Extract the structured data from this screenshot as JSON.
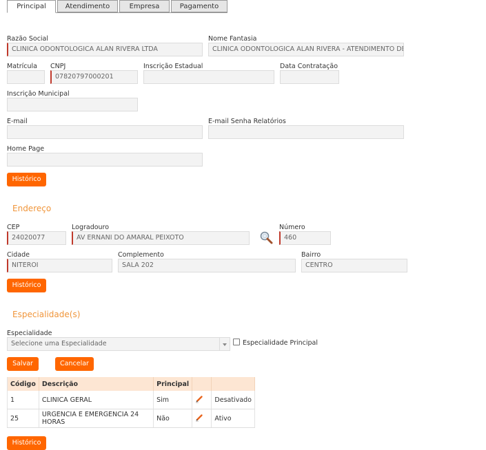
{
  "tabs": [
    {
      "label": "Principal"
    },
    {
      "label": "Atendimento"
    },
    {
      "label": "Empresa"
    },
    {
      "label": "Pagamento"
    }
  ],
  "principal": {
    "razao_social_label": "Razão Social",
    "razao_social_value": "CLINICA ODONTOLOGICA ALAN RIVERA LTDA",
    "nome_fantasia_label": "Nome Fantasia",
    "nome_fantasia_value": "CLINICA ODONTOLOGICA ALAN RIVERA - ATENDIMENTO DE U",
    "matricula_label": "Matrícula",
    "matricula_value": "",
    "cnpj_label": "CNPJ",
    "cnpj_value": "07820797000201",
    "inscricao_estadual_label": "Inscrição Estadual",
    "inscricao_estadual_value": "",
    "data_contratacao_label": "Data Contratação",
    "data_contratacao_value": "",
    "inscricao_municipal_label": "Inscrição Municipal",
    "inscricao_municipal_value": "",
    "email_label": "E-mail",
    "email_value": "",
    "email_senha_label": "E-mail Senha Relatórios",
    "email_senha_value": "",
    "home_page_label": "Home Page",
    "home_page_value": "",
    "historico_label": "Histórico"
  },
  "endereco": {
    "title": "Endereço",
    "cep_label": "CEP",
    "cep_value": "24020077",
    "logradouro_label": "Logradouro",
    "logradouro_value": "AV ERNANI DO AMARAL PEIXOTO",
    "numero_label": "Número",
    "numero_value": "460",
    "cidade_label": "Cidade",
    "cidade_value": "NITEROI",
    "complemento_label": "Complemento",
    "complemento_value": "SALA 202",
    "bairro_label": "Bairro",
    "bairro_value": "CENTRO",
    "historico_label": "Histórico"
  },
  "especialidades": {
    "title": "Especialidade(s)",
    "especialidade_label": "Especialidade",
    "select_value": "Selecione uma Especialidade",
    "principal_checkbox_label": "Especialidade Principal",
    "salvar_label": "Salvar",
    "cancelar_label": "Cancelar",
    "columns": [
      "Código",
      "Descrição",
      "Principal",
      "",
      ""
    ],
    "rows": [
      {
        "codigo": "1",
        "descricao": "CLINICA GERAL",
        "principal": "Sim",
        "status": "Desativado"
      },
      {
        "codigo": "25",
        "descricao": "URGENCIA E EMERGENCIA 24 HORAS",
        "principal": "Não",
        "status": "Ativo"
      }
    ],
    "historico_label": "Histórico"
  },
  "colors": {
    "accent": "#ff6600",
    "section_title": "#f0953a",
    "required": "#c0392b",
    "header_bg": "#fde6d3"
  },
  "icons": {
    "lookup": "magnifier-icon",
    "edit": "pencil-icon"
  }
}
